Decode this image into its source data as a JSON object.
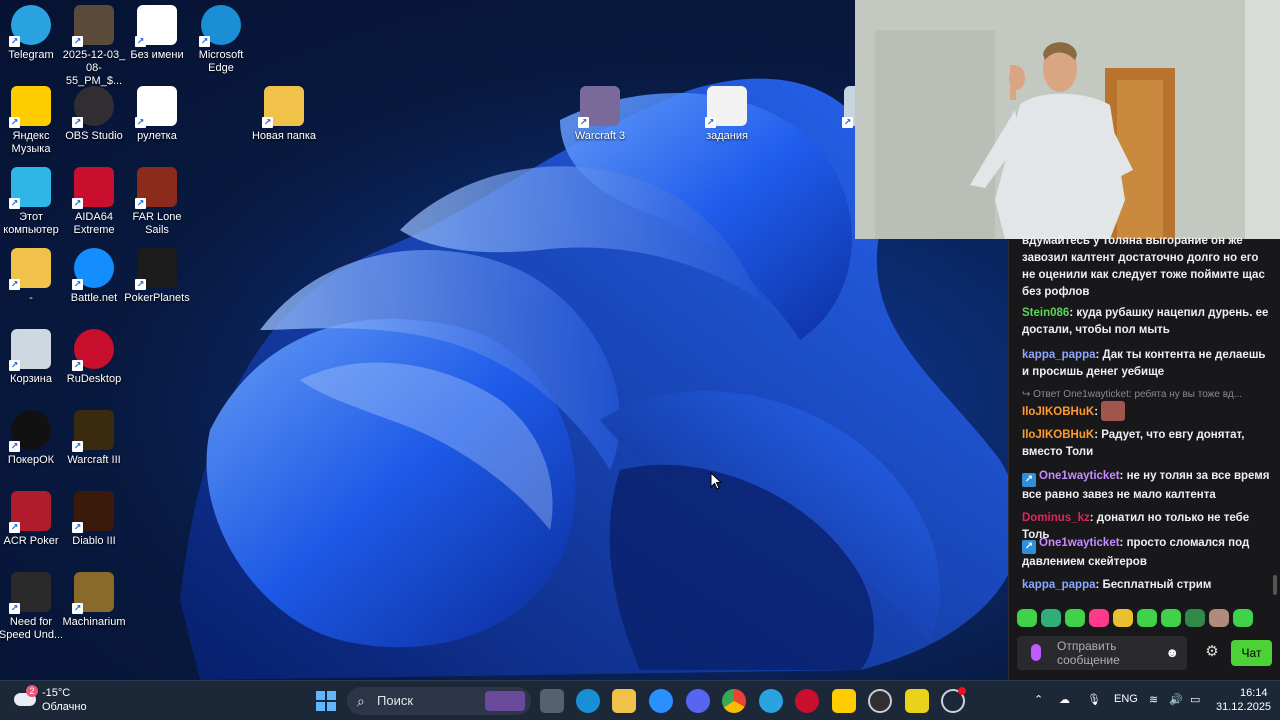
{
  "desktop": {
    "icons": [
      {
        "id": "telegram",
        "label": "Telegram",
        "icon": "telegram-icon",
        "color": "#2aa3e0"
      },
      {
        "id": "screenshot-file",
        "label": "2025-12-03_ 08-55_PM_$...",
        "icon": "image-file-icon",
        "color": "#5a4a3a"
      },
      {
        "id": "bez-imeni",
        "label": "Без имени",
        "icon": "image-file-icon",
        "color": "#ffffff"
      },
      {
        "id": "edge",
        "label": "Microsoft Edge",
        "icon": "edge-icon",
        "color": "#1b8fd6"
      },
      {
        "id": "yandex-music",
        "label": "Яндекс Музыка",
        "icon": "yandex-music-icon",
        "color": "#ffcc00"
      },
      {
        "id": "obs",
        "label": "OBS Studio",
        "icon": "obs-icon",
        "color": "#302e31"
      },
      {
        "id": "ruletka",
        "label": "рулетка",
        "icon": "image-file-icon",
        "color": "#ffffff"
      },
      {
        "id": "new-folder",
        "label": "Новая папка",
        "icon": "folder-icon",
        "color": "#f1c24a"
      },
      {
        "id": "warcraft3-top",
        "label": "Warcraft 3",
        "icon": "warcraft-icon",
        "color": "#7a6a9a"
      },
      {
        "id": "zadaniya",
        "label": "задания",
        "icon": "text-file-icon",
        "color": "#f2f2f2"
      },
      {
        "id": "steam-partial",
        "label": "Ste",
        "icon": "steam-icon",
        "color": "#c7d5e0"
      },
      {
        "id": "this-pc",
        "label": "Этот компьютер",
        "icon": "monitor-icon",
        "color": "#2fb6e6"
      },
      {
        "id": "aida64",
        "label": "AIDA64 Extreme",
        "icon": "aida64-icon",
        "color": "#c8102e"
      },
      {
        "id": "far-lone-sails",
        "label": "FAR Lone Sails",
        "icon": "game-icon",
        "color": "#8a2b1c"
      },
      {
        "id": "dash-folder",
        "label": "-",
        "icon": "folder-icon",
        "color": "#f1c24a"
      },
      {
        "id": "battlenet",
        "label": "Battle.net",
        "icon": "battlenet-icon",
        "color": "#148eff"
      },
      {
        "id": "pokerplanets",
        "label": "PokerPlanets",
        "icon": "poker-icon",
        "color": "#1c1c1c"
      },
      {
        "id": "recycle-bin",
        "label": "Корзина",
        "icon": "recycle-bin-icon",
        "color": "#cfd8e0"
      },
      {
        "id": "rudesktop",
        "label": "RuDesktop",
        "icon": "rudesktop-icon",
        "color": "#c8102e"
      },
      {
        "id": "pokerok",
        "label": "ПокерОК",
        "icon": "poker-icon",
        "color": "#111111"
      },
      {
        "id": "warcraft3",
        "label": "Warcraft III",
        "icon": "warcraft-icon",
        "color": "#3a2a10"
      },
      {
        "id": "acr-poker",
        "label": "ACR Poker",
        "icon": "poker-icon",
        "color": "#b01c2e"
      },
      {
        "id": "diablo3",
        "label": "Diablo III",
        "icon": "diablo-icon",
        "color": "#3a1a0a"
      },
      {
        "id": "nfs",
        "label": "Need for Speed Und...",
        "icon": "nfs-icon",
        "color": "#2a2a2a"
      },
      {
        "id": "machinarium",
        "label": "Machinarium",
        "icon": "machinarium-icon",
        "color": "#8a6a2a"
      }
    ]
  },
  "chat": {
    "messages": [
      {
        "kind": "text",
        "text": "вдумайтесь у толяна выгорание он же завозил калтент достаточно долго но его не оценили как следует тоже поймите щас без рофлов"
      },
      {
        "kind": "msg",
        "user": "Stein086",
        "user_color": "#5fd35a",
        "text": " куда рубашку нацепил дурень. ее достали, чтобы пол мыть"
      },
      {
        "kind": "msg",
        "user": "kappa_pappa",
        "user_color": "#8fa8ff",
        "text": " Дак ты контента не делаешь и просишь денег уебище"
      },
      {
        "kind": "reply",
        "text": "↪ Ответ One1wayticket: ребята ну вы тоже вд..."
      },
      {
        "kind": "msg",
        "user": "IloJIKOBHuK",
        "user_color": "#ff9b2e",
        "text": ""
      },
      {
        "kind": "msg",
        "user": "IloJIKOBHuK",
        "user_color": "#ff9b2e",
        "text": " Радует, что евгу донятат, вместо Толи"
      },
      {
        "kind": "msg",
        "user": "One1wayticket",
        "user_color": "#c58cff",
        "badge": true,
        "text": " не ну толян за все время все равно завез не мало калтента"
      },
      {
        "kind": "msg",
        "user": "Dominus_kz",
        "user_color": "#e0245e",
        "text": " донатил но только не тебе Толь"
      },
      {
        "kind": "msg",
        "user": "One1wayticket",
        "user_color": "#c58cff",
        "badge": true,
        "text": " просто сломался под давлением скейтеров"
      },
      {
        "kind": "msg",
        "user": "kappa_pappa",
        "user_color": "#8fa8ff",
        "text": " Бесплатный стрим"
      }
    ],
    "input_placeholder": "Отправить сообщение",
    "send_label": "Чат",
    "colors": {
      "background": "#18181b",
      "send": "#4cd137"
    }
  },
  "taskbar": {
    "weather_temp": "-15°C",
    "weather_desc": "Облачно",
    "weather_badge": "2",
    "search_label": "Поиск",
    "lang": "ENG",
    "time": "16:14",
    "date": "31.12.2025",
    "apps": [
      "windows-start-icon",
      "task-view-icon",
      "edge-icon",
      "file-explorer-icon",
      "cortana-icon",
      "discord-icon",
      "chrome-icon",
      "telegram-icon",
      "rudesktop-icon",
      "yandex-music-icon",
      "obs-icon",
      "app-icon",
      "steam-icon"
    ]
  }
}
